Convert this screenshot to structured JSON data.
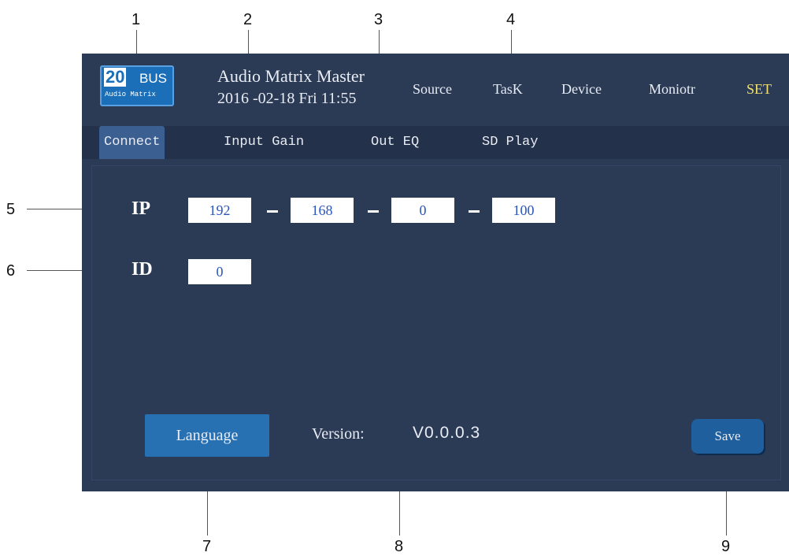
{
  "callouts": [
    "1",
    "2",
    "3",
    "4",
    "5",
    "6",
    "7",
    "8",
    "9"
  ],
  "logo": {
    "number": "20",
    "word": "BUS",
    "subtitle": "Audio Matrix"
  },
  "header": {
    "title": "Audio Matrix Master",
    "datetime": "2016 -02-18 Fri 11:55",
    "menu": [
      {
        "label": "Source",
        "active": false
      },
      {
        "label": "TasK",
        "active": false
      },
      {
        "label": "Device",
        "active": false
      },
      {
        "label": "Moniotr",
        "active": false
      },
      {
        "label": "SET",
        "active": true
      }
    ]
  },
  "tabs": [
    {
      "label": "Connect",
      "active": true
    },
    {
      "label": "Input Gain",
      "active": false
    },
    {
      "label": "Out EQ",
      "active": false
    },
    {
      "label": "SD Play",
      "active": false
    }
  ],
  "connect": {
    "ip_label": "IP",
    "ip": [
      "192",
      "168",
      "0",
      "100"
    ],
    "id_label": "ID",
    "id": "0"
  },
  "footer": {
    "language_label": "Language",
    "version_label": "Version:",
    "version_value": "V0.0.0.3",
    "save_label": "Save"
  },
  "colors": {
    "screen_bg": "#2b3a55",
    "tabbar_bg": "#24314a",
    "active_tab": "#3a5f90",
    "active_menu": "#f2e06a",
    "button_blue": "#2771b3",
    "ip_text": "#2a55c0"
  }
}
